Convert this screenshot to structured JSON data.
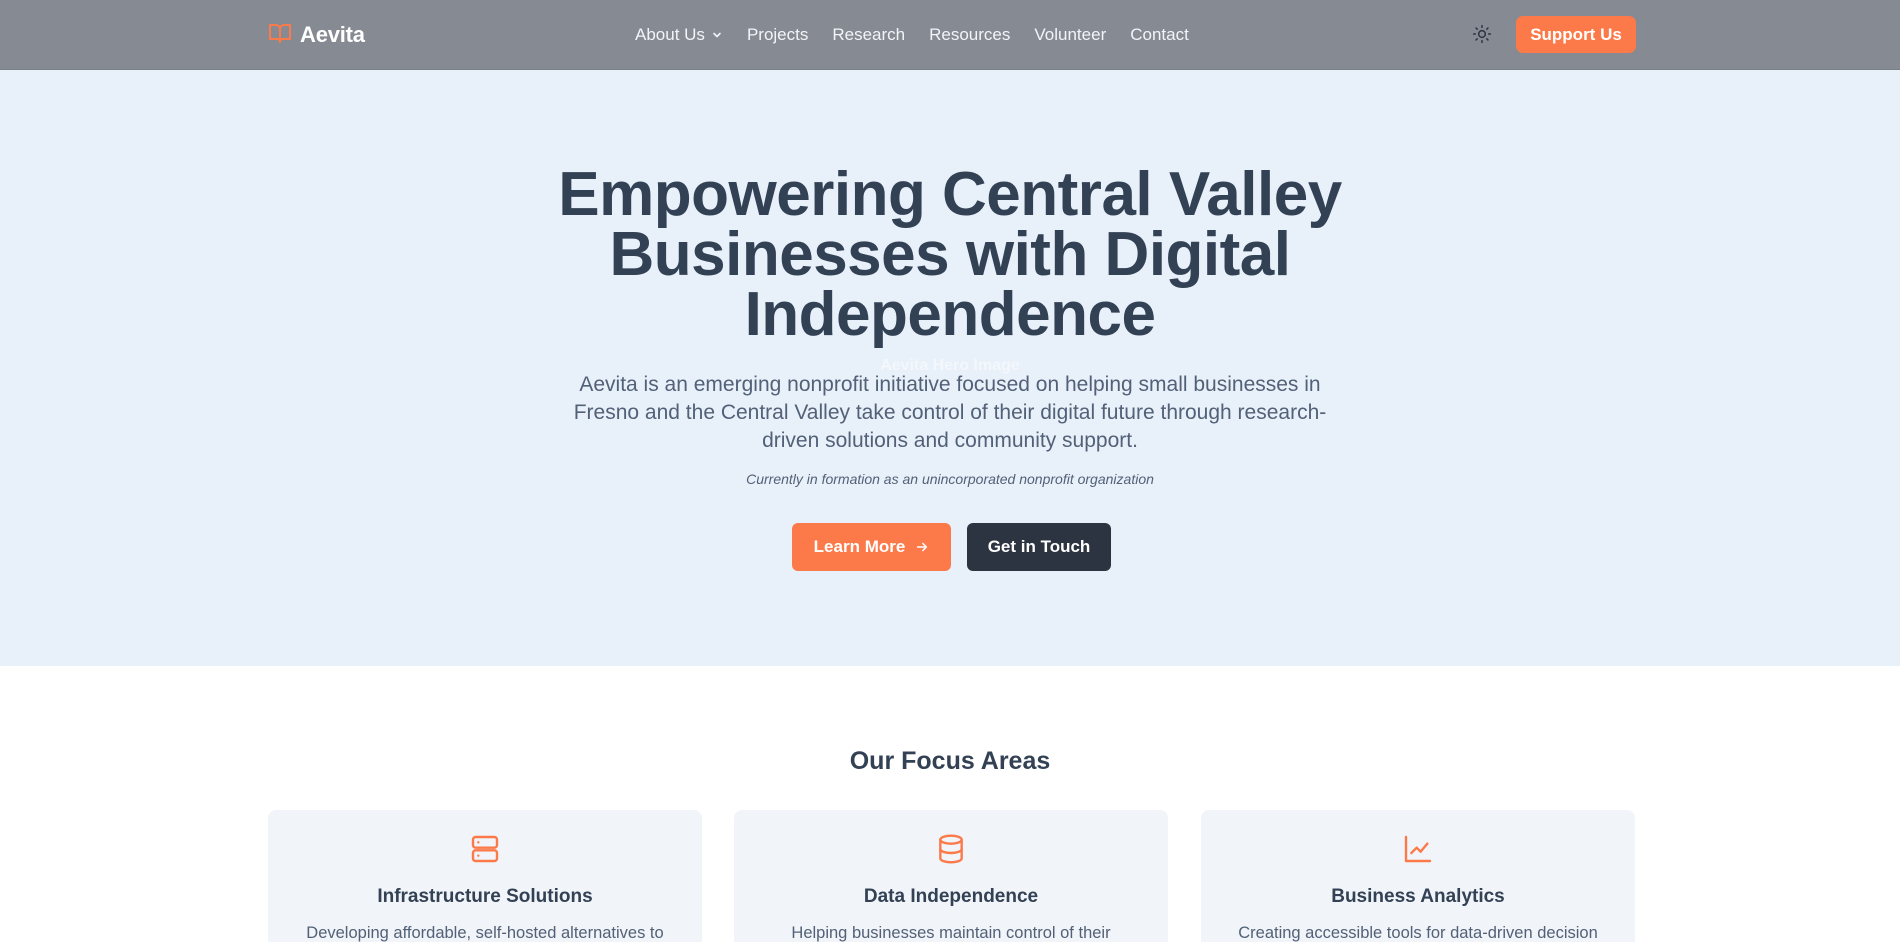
{
  "nav": {
    "brand": "Aevita",
    "brand_icon": "book-open-icon",
    "items": [
      {
        "label": "About Us",
        "has_dropdown": true
      },
      {
        "label": "Projects"
      },
      {
        "label": "Research"
      },
      {
        "label": "Resources"
      },
      {
        "label": "Volunteer"
      },
      {
        "label": "Contact"
      }
    ],
    "theme_icon": "sun-icon",
    "support_label": "Support Us"
  },
  "hero": {
    "image_alt": "Aevita Hero Image",
    "title": "Empowering Central Valley Businesses with Digital Independence",
    "subtitle": "Aevita is an emerging nonprofit initiative focused on helping small businesses in Fresno and the Central Valley take control of their digital future through research-driven solutions and community support.",
    "note": "Currently in formation as an unincorporated nonprofit organization",
    "primary_cta": "Learn More",
    "secondary_cta": "Get in Touch"
  },
  "focus": {
    "title": "Our Focus Areas",
    "cards": [
      {
        "icon": "server-icon",
        "title": "Infrastructure Solutions",
        "desc": "Developing affordable, self-hosted alternatives to"
      },
      {
        "icon": "database-icon",
        "title": "Data Independence",
        "desc": "Helping businesses maintain control of their"
      },
      {
        "icon": "line-chart-icon",
        "title": "Business Analytics",
        "desc": "Creating accessible tools for data-driven decision"
      }
    ]
  },
  "colors": {
    "accent": "#fc7a4a",
    "nav_bg": "#868a92",
    "hero_bg": "#e8f0fa",
    "dark_button": "#2d3441",
    "heading": "#334155",
    "body_text": "#526177"
  }
}
